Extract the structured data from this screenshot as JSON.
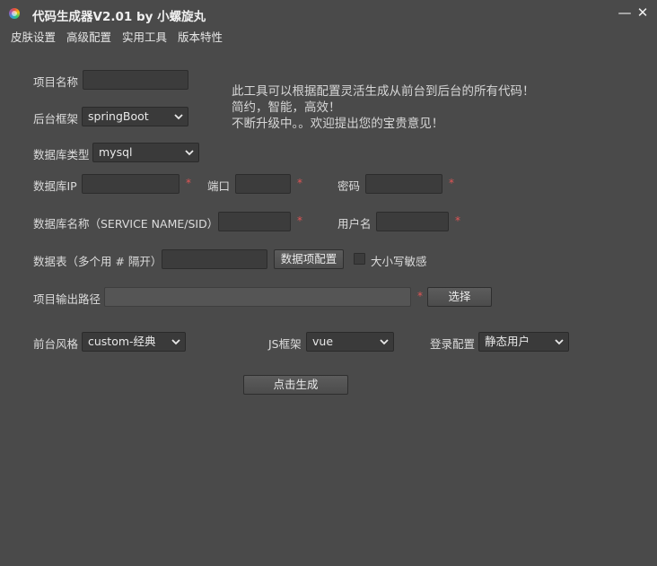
{
  "window": {
    "title": "代码生成器V2.01 by 小螺旋丸",
    "minimize_glyph": "—",
    "close_glyph": "✕"
  },
  "menu": [
    "皮肤设置",
    "高级配置",
    "实用工具",
    "版本特性"
  ],
  "form": {
    "project_name_label": "项目名称",
    "project_name_value": "",
    "backend_label": "后台框架",
    "backend_value": "springBoot",
    "db_type_label": "数据库类型",
    "db_type_value": "mysql",
    "db_ip_label": "数据库IP",
    "db_ip_value": "",
    "port_label": "端口",
    "port_value": "",
    "password_label": "密码",
    "password_value": "",
    "db_name_label": "数据库名称（SERVICE NAME/SID）",
    "db_name_value": "",
    "username_label": "用户名",
    "username_value": "",
    "tables_label": "数据表（多个用 # 隔开）",
    "tables_value": "",
    "table_config_button": "数据项配置",
    "case_sensitive_label": "大小写敏感",
    "output_path_label": "项目输出路径",
    "output_path_value": "",
    "choose_button": "选择",
    "frontend_style_label": "前台风格",
    "frontend_style_value": "custom-经典",
    "js_framework_label": "JS框架",
    "js_framework_value": "vue",
    "login_config_label": "登录配置",
    "login_config_value": "静态用户",
    "generate_button": "点击生成",
    "required_mark": "*"
  },
  "info_lines": [
    "此工具可以根据配置灵活生成从前台到后台的所有代码！",
    "简约，智能，高效！",
    "不断升级中。。欢迎提出您的宝贵意见！"
  ],
  "colors": {
    "background": "#4a4a4a",
    "required": "#e05555"
  }
}
